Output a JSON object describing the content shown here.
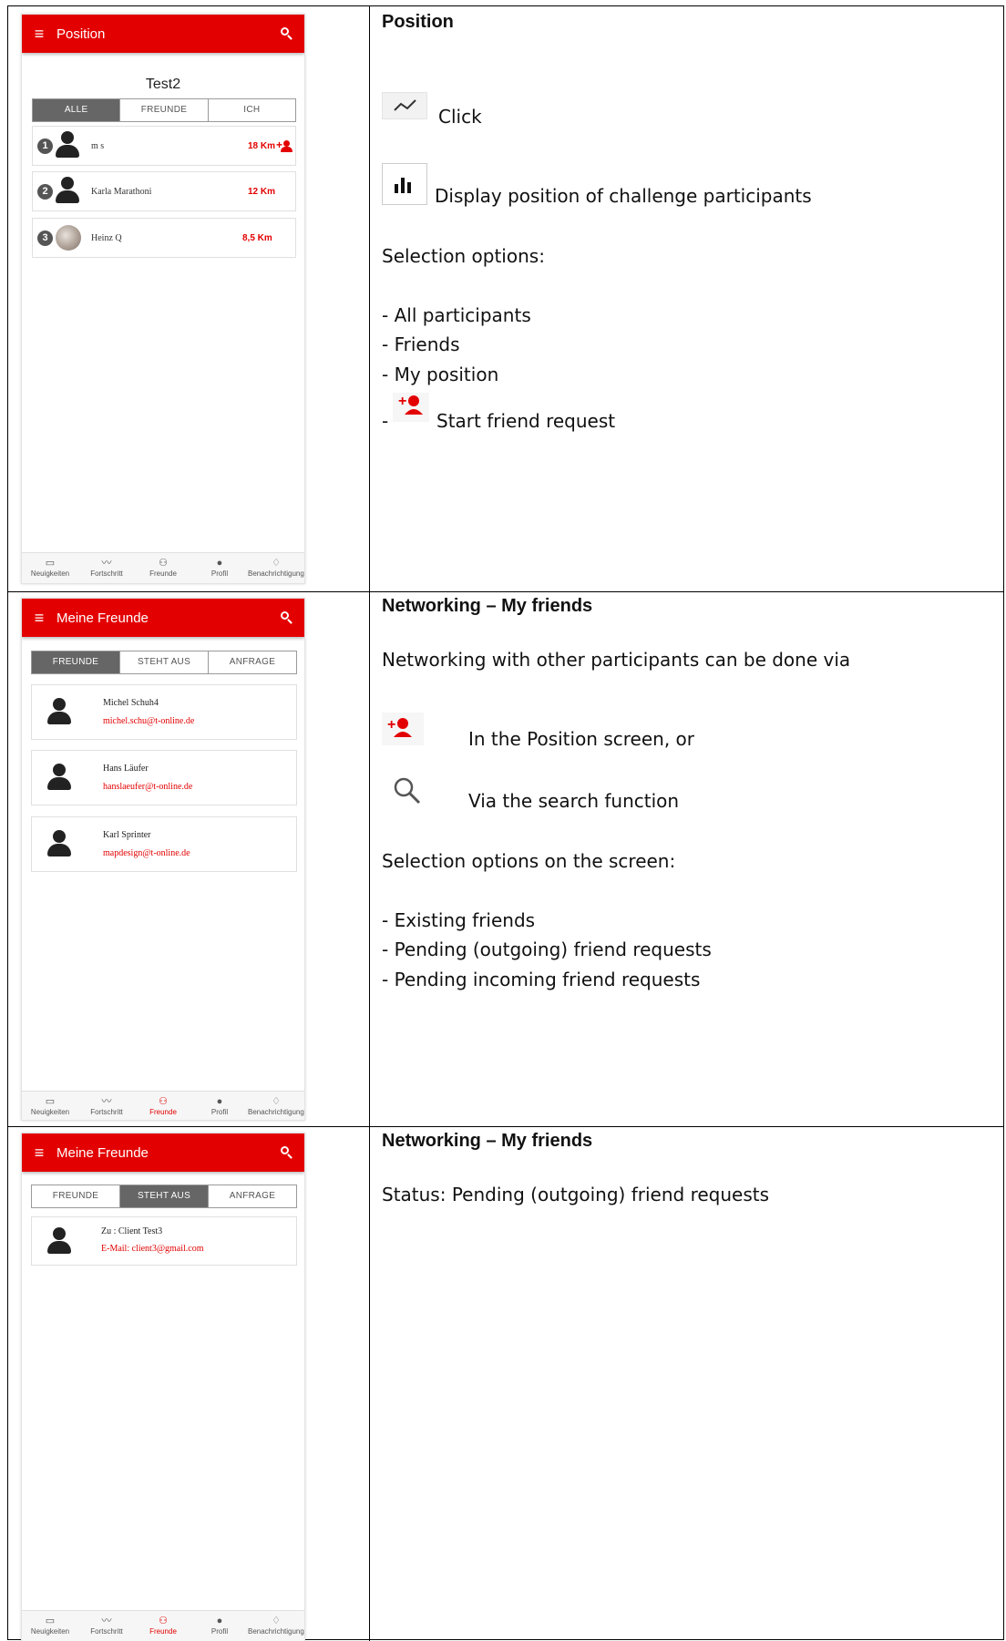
{
  "colors": {
    "accent": "#e30000",
    "segment_active": "#666666"
  },
  "nav": [
    "Neuigkeiten",
    "Fortschritt",
    "Freunde",
    "Profil",
    "Benachrichtigungen"
  ],
  "row1": {
    "phone": {
      "title": "Position",
      "subtitle": "Test2",
      "tabs": [
        "ALLE",
        "FREUNDE",
        "ICH"
      ],
      "list": [
        {
          "rank": "1",
          "name": "m s",
          "distance": "18 Km"
        },
        {
          "rank": "2",
          "name": "Karla Marathoni",
          "distance": "12 Km"
        },
        {
          "rank": "3",
          "name": "Heinz Q",
          "distance": "8,5 Km"
        }
      ]
    },
    "text": {
      "heading": "Position",
      "click": "Click",
      "display": "Display position of challenge participants",
      "selection": "Selection options:",
      "opt1": "- All participants",
      "opt2": "- Friends",
      "opt3": "- My position",
      "dash": "-",
      "opt4": "Start friend request"
    }
  },
  "row2": {
    "phone": {
      "title": "Meine Freunde",
      "tabs": [
        "FREUNDE",
        "STEHT AUS",
        "ANFRAGE"
      ],
      "friends": [
        {
          "name": "Michel Schuh4",
          "email": "michel.schu@t-online.de"
        },
        {
          "name": "Hans Läufer",
          "email": "hanslaeufer@t-online.de"
        },
        {
          "name": "Karl Sprinter",
          "email": "mapdesign@t-online.de"
        }
      ]
    },
    "text": {
      "heading": "Networking – My friends",
      "intro": "Networking with other participants can be done via",
      "via1": "In the Position screen, or",
      "via2": "Via the search function",
      "selection": "Selection options on the screen:",
      "opt1": "- Existing friends",
      "opt2": "- Pending (outgoing) friend requests",
      "opt3": "- Pending incoming friend requests"
    }
  },
  "row3": {
    "phone": {
      "title": "Meine Freunde",
      "tabs": [
        "FREUNDE",
        "STEHT AUS",
        "ANFRAGE"
      ],
      "pending": {
        "name": "Zu : Client Test3",
        "email": "E-Mail: client3@gmail.com"
      }
    },
    "text": {
      "heading": "Networking – My friends",
      "status": "Status: Pending (outgoing) friend requests"
    }
  }
}
